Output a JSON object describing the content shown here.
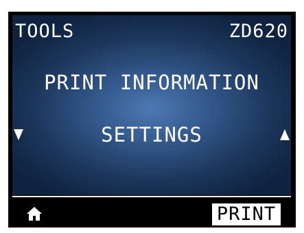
{
  "header": {
    "title": "TOOLS",
    "model": "ZD620"
  },
  "menu": {
    "items": [
      {
        "label": "PRINT INFORMATION"
      },
      {
        "label": "SETTINGS"
      }
    ]
  },
  "icons": {
    "down": "down-arrow-icon",
    "up": "up-arrow-icon",
    "home": "home-icon"
  },
  "footer": {
    "action_label": "PRINT"
  },
  "colors": {
    "screen_bg": "#000000",
    "gradient_center": "#4d79b3",
    "gradient_edge": "#0f2240",
    "text": "#ffffff"
  }
}
